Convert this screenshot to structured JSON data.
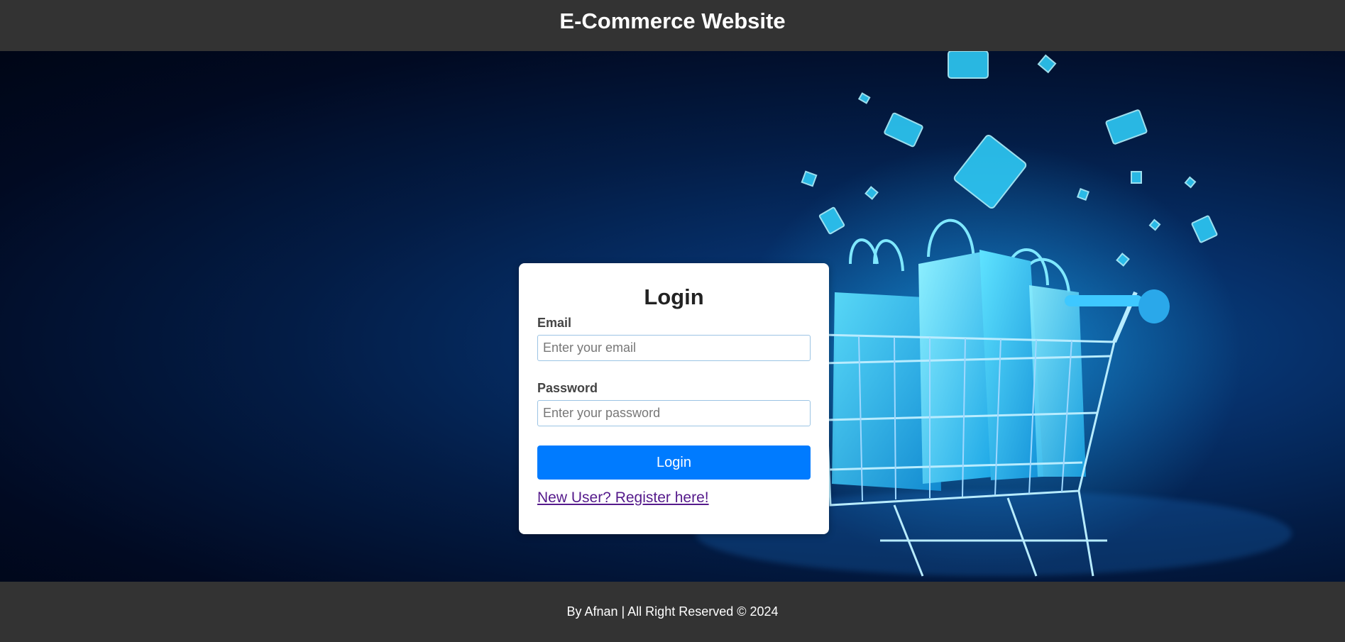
{
  "header": {
    "title": "E-Commerce Website"
  },
  "login": {
    "title": "Login",
    "email_label": "Email",
    "email_placeholder": "Enter your email",
    "email_value": "",
    "password_label": "Password",
    "password_placeholder": "Enter your password",
    "password_value": "",
    "button_label": "Login",
    "register_link": "New User? Register here!"
  },
  "footer": {
    "text": "By Afnan | All Right Reserved © 2024"
  },
  "colors": {
    "header_bg": "#333333",
    "primary_button": "#007bff",
    "visited_link": "#551a8b",
    "hero_glow": "#00c8ff"
  },
  "hero": {
    "image": "glowing-shopping-cart-with-bags-and-credit-cards"
  }
}
